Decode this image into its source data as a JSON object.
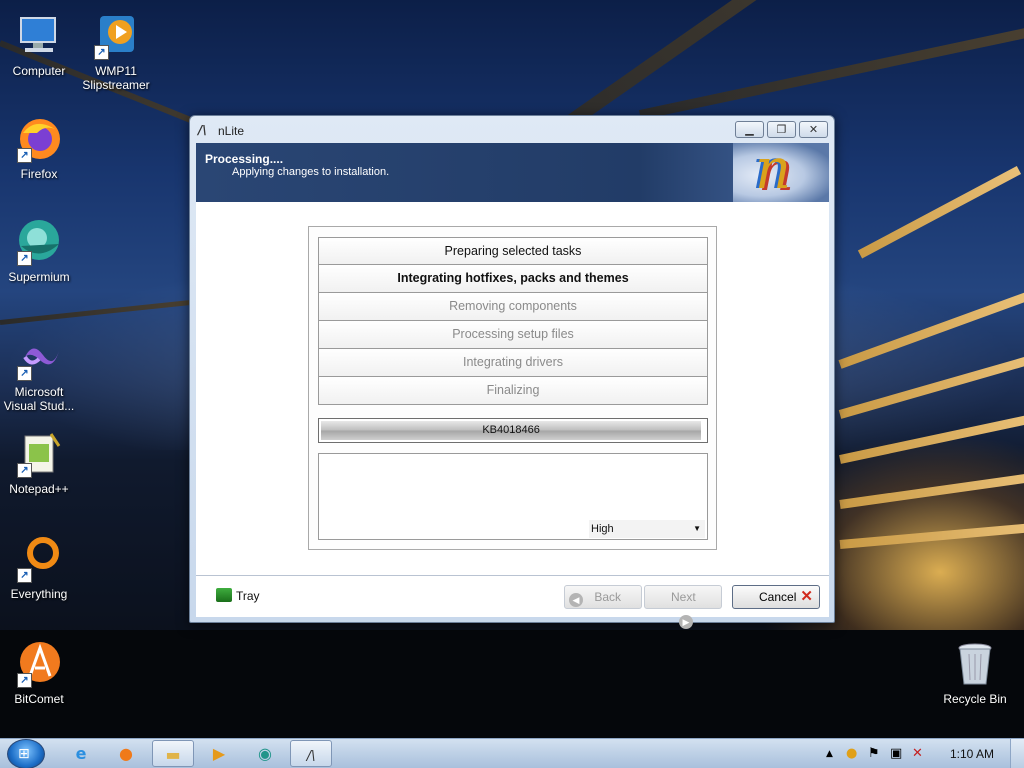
{
  "desktop": {
    "icons": [
      {
        "label": "Computer",
        "icon": "computer-icon"
      },
      {
        "label": "WMP11 Slipstreamer",
        "icon": "wmp11-slipstreamer-icon"
      },
      {
        "label": "Firefox",
        "icon": "firefox-icon"
      },
      {
        "label": "Supermium",
        "icon": "supermium-icon"
      },
      {
        "label": "Microsoft Visual Stud...",
        "icon": "visual-studio-icon"
      },
      {
        "label": "Notepad++",
        "icon": "notepad-plus-plus-icon"
      },
      {
        "label": "Everything",
        "icon": "everything-icon"
      },
      {
        "label": "BitComet",
        "icon": "bitcomet-icon"
      },
      {
        "label": "Recycle Bin",
        "icon": "recycle-bin-icon"
      }
    ]
  },
  "window": {
    "title": "nLite",
    "title_icon": "nlite-icon",
    "controls": {
      "minimize": "minimize-icon",
      "restore": "restore-icon",
      "close": "close-icon"
    },
    "header": {
      "title": "Processing....",
      "subtitle": "Applying changes to installation."
    },
    "tasks": [
      {
        "label": "Preparing selected tasks",
        "state": "done"
      },
      {
        "label": "Integrating hotfixes, packs and themes",
        "state": "active"
      },
      {
        "label": "Removing components",
        "state": "pending"
      },
      {
        "label": "Processing setup files",
        "state": "pending"
      },
      {
        "label": "Integrating drivers",
        "state": "pending"
      },
      {
        "label": "Finalizing",
        "state": "pending"
      }
    ],
    "progress": {
      "label": "KB4018466",
      "fraction": 0.99
    },
    "priority": {
      "selected": "High"
    },
    "footer": {
      "tray_label": "Tray",
      "back_label": "Back",
      "next_label": "Next",
      "cancel_label": "Cancel"
    }
  },
  "taskbar": {
    "items": [
      "internet-explorer-icon",
      "firefox-icon",
      "explorer-icon",
      "media-player-icon",
      "supermium-icon",
      "nlite-icon"
    ],
    "tray_icons": [
      "show-hidden-icons-icon",
      "notification-icon",
      "action-center-flag-icon",
      "network-icon",
      "volume-muted-icon"
    ],
    "clock": "1:10 AM"
  }
}
